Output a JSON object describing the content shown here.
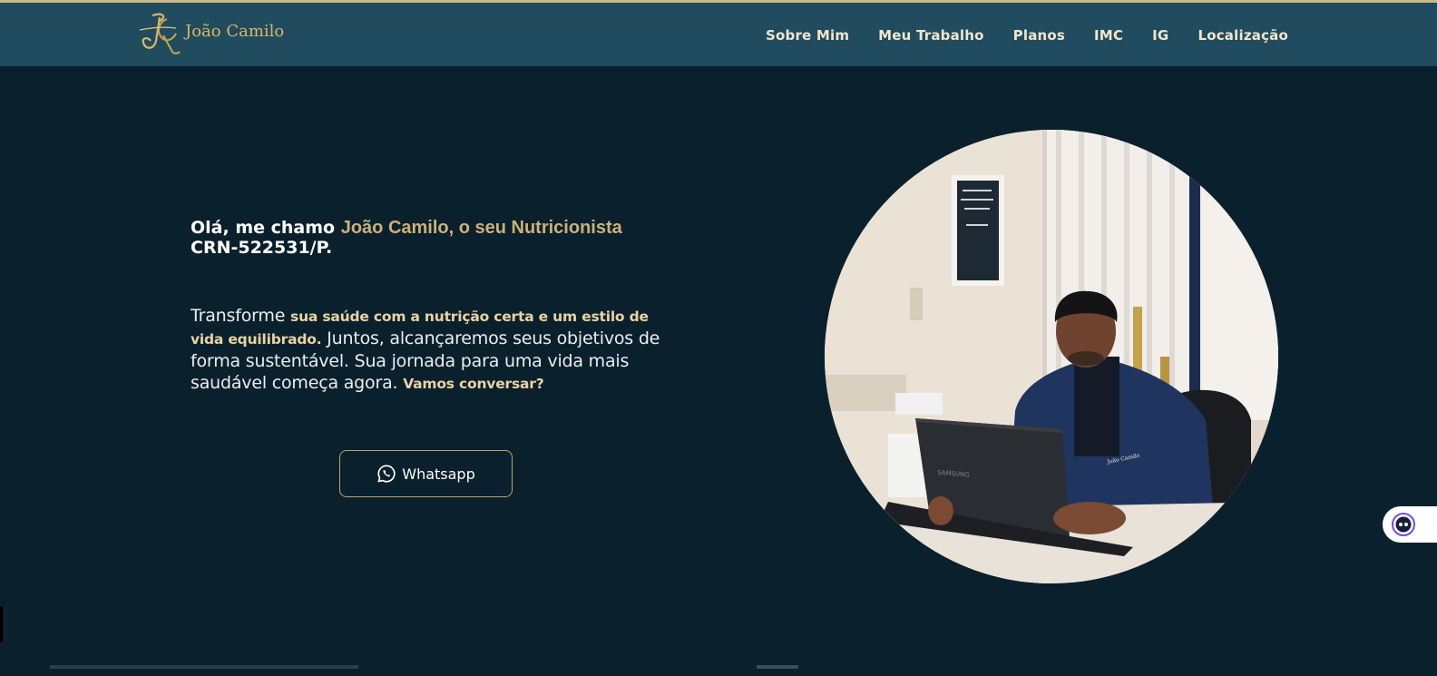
{
  "brand": {
    "name": "João Camilo",
    "mark": "JC"
  },
  "nav": {
    "items": [
      {
        "label": "Sobre Mim"
      },
      {
        "label": "Meu Trabalho"
      },
      {
        "label": "Planos"
      },
      {
        "label": "IMC"
      },
      {
        "label": "IG"
      },
      {
        "label": "Localização"
      }
    ]
  },
  "hero": {
    "greeting": "Olá, me chamo ",
    "name_title": "João Camilo, o seu Nutricionista",
    "crn": "CRN-522531/P.",
    "intro_1": "Transforme ",
    "intro_bold_1": "sua saúde com a nutrição certa e um estilo de vida equilibrado.",
    "intro_2": " Juntos, alcançaremos seus objetivos de forma sustentável. Sua jornada para uma vida mais saudável começa agora. ",
    "intro_bold_2": "Vamos conversar?",
    "cta_label": "Whatsapp"
  },
  "photo": {
    "laptop_brand": "SAMSUNG",
    "jacket_text": "João Camilo"
  },
  "colors": {
    "page_bg": "#0b202d",
    "navbar_bg": "#214b5e",
    "accent_gold": "#cbb276",
    "button_border": "#bda466"
  },
  "icons": {
    "cta": "whatsapp-icon",
    "widget": "chat-assistant-icon"
  }
}
